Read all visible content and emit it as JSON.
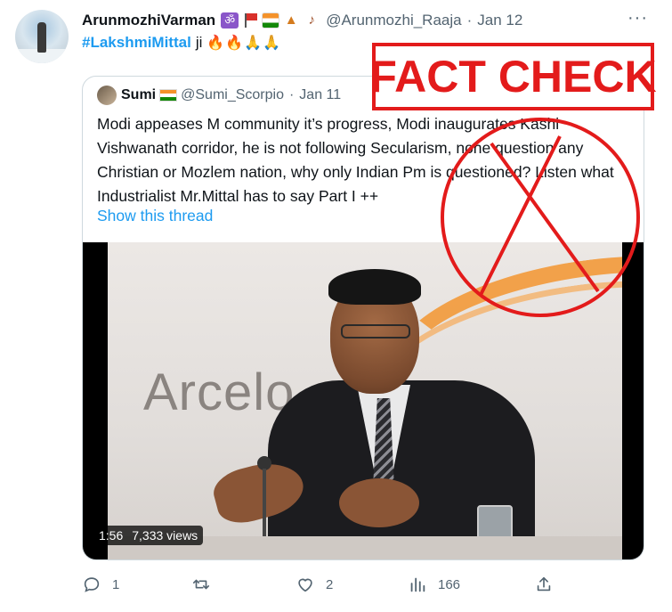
{
  "tweet": {
    "author_name": "ArunmozhiVarman",
    "author_emojis": [
      "om-symbol",
      "red-flag",
      "india-flag",
      "temple",
      "violin"
    ],
    "handle": "@Arunmozhi_Raaja",
    "separator": "·",
    "date": "Jan 12",
    "more_label": "···",
    "hashtag": "#LakshmiMittal",
    "text_suffix": "ji",
    "emoji_tail": "🔥🔥🙏🙏"
  },
  "quote": {
    "author_name": "Sumi",
    "handle": "@Sumi_Scorpio",
    "separator": "·",
    "date": "Jan 11",
    "text": "Modi appeases M community it’s progress, Modi inaugurates Kashi Vishwanath corridor, he is not following Secularism, none question any Christian or Mozlem nation, why only Indian Pm is questioned? Listen what Industrialist Mr.Mittal has to say Part I ++",
    "show_thread": "Show this thread",
    "media": {
      "backdrop_text": "Arcelo",
      "duration": "1:56",
      "views": "7,333 views"
    }
  },
  "overlay": {
    "fact_check": "FACT CHECK",
    "stamp_color": "#e31b1b"
  },
  "actions": {
    "reply_count": "1",
    "retweet_count": "",
    "like_count": "2",
    "views_count": "166"
  },
  "colors": {
    "link": "#1d9bf0",
    "muted": "#536471",
    "border": "#cfd9de"
  }
}
